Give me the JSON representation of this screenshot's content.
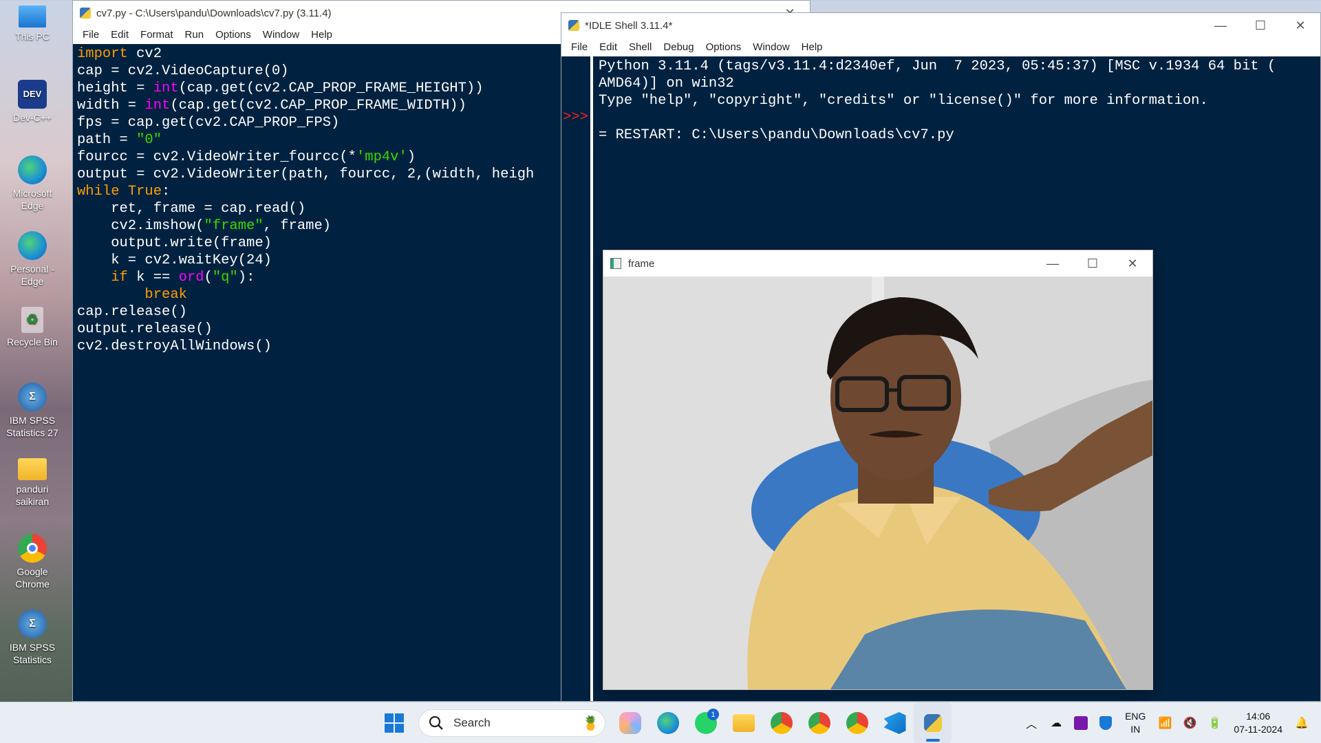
{
  "desktop": {
    "icons": [
      {
        "label": "This PC"
      },
      {
        "label": "Dev-C++",
        "short": "DEV"
      },
      {
        "label": "Microsoft Edge"
      },
      {
        "label": "Personal - Edge"
      },
      {
        "label": "Recycle Bin"
      },
      {
        "label": "IBM SPSS Statistics 27"
      },
      {
        "label": "panduri saikiran"
      },
      {
        "label": "Google Chrome"
      },
      {
        "label": "IBM SPSS Statistics"
      }
    ]
  },
  "editor": {
    "title": "cv7.py - C:\\Users\\pandu\\Downloads\\cv7.py (3.11.4)",
    "menu": [
      "File",
      "Edit",
      "Format",
      "Run",
      "Options",
      "Window",
      "Help"
    ],
    "code_lines": [
      "import cv2",
      "cap = cv2.VideoCapture(0)",
      "height = int(cap.get(cv2.CAP_PROP_FRAME_HEIGHT))",
      "width = int(cap.get(cv2.CAP_PROP_FRAME_WIDTH))",
      "fps = cap.get(cv2.CAP_PROP_FPS)",
      "path = \"0\"",
      "fourcc = cv2.VideoWriter_fourcc(*'mp4v')",
      "output = cv2.VideoWriter(path, fourcc, 2,(width, heigh",
      "while True:",
      "    ret, frame = cap.read()",
      "    cv2.imshow(\"frame\", frame)",
      "    output.write(frame)",
      "    k = cv2.waitKey(24)",
      "    if k == ord(\"q\"):",
      "        break",
      "cap.release()",
      "output.release()",
      "cv2.destroyAllWindows()"
    ]
  },
  "shell": {
    "title": "*IDLE Shell 3.11.4*",
    "menu": [
      "File",
      "Edit",
      "Shell",
      "Debug",
      "Options",
      "Window",
      "Help"
    ],
    "prompt": ">>>",
    "lines": [
      "Python 3.11.4 (tags/v3.11.4:d2340ef, Jun  7 2023, 05:45:37) [MSC v.1934 64 bit (",
      "AMD64)] on win32",
      "Type \"help\", \"copyright\", \"credits\" or \"license()\" for more information.",
      "",
      "= RESTART: C:\\Users\\pandu\\Downloads\\cv7.py"
    ]
  },
  "frame_window": {
    "title": "frame"
  },
  "taskbar": {
    "search_placeholder": "Search",
    "whatsapp_badge": "1",
    "language": {
      "line1": "ENG",
      "line2": "IN"
    },
    "time": "14:06",
    "date": "07-11-2024"
  },
  "colors": {
    "idle_bg": "#002240",
    "keyword": "#ff9d00",
    "builtin": "#ff00ff",
    "string": "#3ad900",
    "prompt": "#ff2020"
  }
}
